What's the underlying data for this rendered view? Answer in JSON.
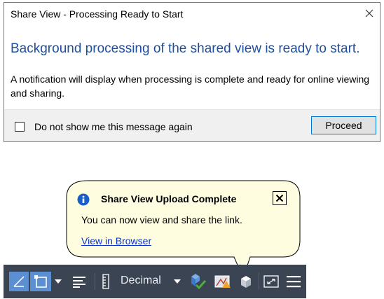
{
  "dialog": {
    "title": "Share View - Processing Ready to Start",
    "heading": "Background processing of the shared view is ready to start.",
    "body": "A notification will display when processing is complete and ready for online viewing and sharing.",
    "checkbox_label": "Do not show me this message again",
    "checkbox_checked": false,
    "proceed_label": "Proceed",
    "close_icon": "close-icon"
  },
  "balloon": {
    "title": "Share View Upload Complete",
    "message": "You can now view and share the link.",
    "link": "View in Browser",
    "icon": "info-icon",
    "close_icon": "close-icon"
  },
  "statusbar": {
    "units_label": "Decimal",
    "icons": [
      "ortho-icon",
      "selection-cycling-icon",
      "chevron-down-icon",
      "lineweight-icon",
      "ruler-icon",
      "chevron-down-icon",
      "quick-properties-icon",
      "annotation-monitor-icon",
      "share-view-icon",
      "fullscreen-icon",
      "menu-icon"
    ]
  },
  "colors": {
    "heading": "#1e4f9c",
    "balloon_fill": "#fffde0",
    "statusbar_bg": "#3b4453",
    "active_button": "#5b8fd1",
    "link": "#0a32c8"
  }
}
